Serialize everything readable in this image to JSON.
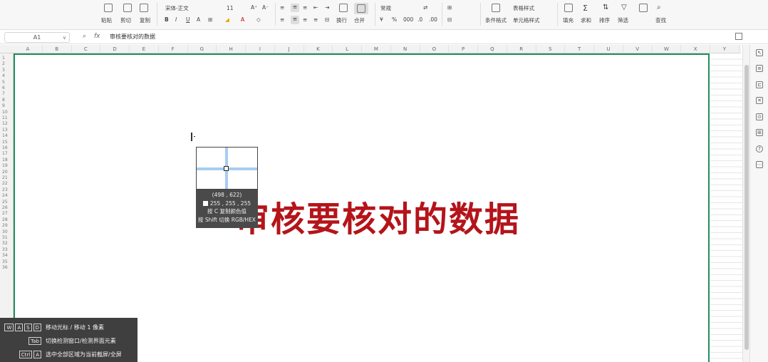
{
  "ribbon": {
    "paste_label": "粘贴",
    "cut_label": "剪切",
    "copy_label": "复制",
    "font_name": "宋体-正文",
    "font_size": "11",
    "number_format": "常规",
    "wrap_label": "换行",
    "merge_label": "合并",
    "table_style_label": "表格样式",
    "cond_format_label": "条件格式",
    "cell_style_label": "单元格样式",
    "fill_label": "填充",
    "sum_label": "求和",
    "sort_label": "排序",
    "filter_label": "筛选",
    "find_label": "查找",
    "bold": "B",
    "italic": "I",
    "underline": "U"
  },
  "formula_bar": {
    "name_box": "A1",
    "fx": "fx",
    "formula_text": "审核要核对的数据"
  },
  "columns": [
    "A",
    "B",
    "C",
    "D",
    "E",
    "F",
    "G",
    "H",
    "I",
    "J",
    "K",
    "L",
    "M",
    "N",
    "O",
    "P",
    "Q",
    "R",
    "S",
    "T",
    "U",
    "V",
    "W",
    "X",
    "Y"
  ],
  "rows": [
    "1",
    "2",
    "3",
    "4",
    "5",
    "6",
    "7",
    "8",
    "9",
    "10",
    "11",
    "12",
    "13",
    "14",
    "15",
    "16",
    "17",
    "18",
    "19",
    "20",
    "21",
    "22",
    "23",
    "24",
    "25",
    "26",
    "27",
    "28",
    "29",
    "30",
    "31",
    "32",
    "33",
    "34",
    "35",
    "36"
  ],
  "capture": {
    "coords": "(498 , 622)",
    "rgb": "255 , 255 , 255",
    "hint_copy": "按 C 复制颜色值",
    "hint_switch": "按 Shift 切换 RGB/HEX"
  },
  "cell_text": "审核要核对的数据",
  "cell_color": "#b4141a",
  "selection_color": "#1f8f5f",
  "hints": [
    {
      "keys": [
        "W",
        "A",
        "S",
        "D"
      ],
      "text": "移动光标 / 移动 1 像素"
    },
    {
      "keys": [
        "Tab"
      ],
      "text": "切换检测窗口/检测界面元素"
    },
    {
      "keys": [
        "Ctrl",
        "A"
      ],
      "text": "选中全部区域为当前截屏/全屏"
    }
  ]
}
